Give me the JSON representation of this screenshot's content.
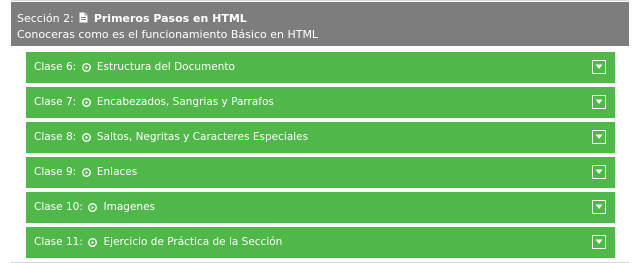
{
  "section": {
    "prefix": "Sección 2:",
    "title": "Primeros Pasos en HTML",
    "subtitle": "Conoceras como es el funcionamiento Básico en HTML",
    "icon": "document-icon"
  },
  "lessons": [
    {
      "prefix": "Clase 6:",
      "title": "Estructura del Documento"
    },
    {
      "prefix": "Clase 7:",
      "title": "Encabezados, Sangrias y Parrafos"
    },
    {
      "prefix": "Clase 8:",
      "title": "Saltos, Negritas y Caracteres Especiales"
    },
    {
      "prefix": "Clase 9:",
      "title": "Enlaces"
    },
    {
      "prefix": "Clase 10:",
      "title": "Imagenes"
    },
    {
      "prefix": "Clase 11:",
      "title": "Ejercicio de Práctica de la Sección"
    }
  ],
  "colors": {
    "header_bg": "#7d7d7d",
    "lesson_bg": "#4fb848",
    "text": "#ffffff"
  },
  "icons": {
    "lesson": "play-circle-icon",
    "toggle": "expand-toggle-icon"
  }
}
